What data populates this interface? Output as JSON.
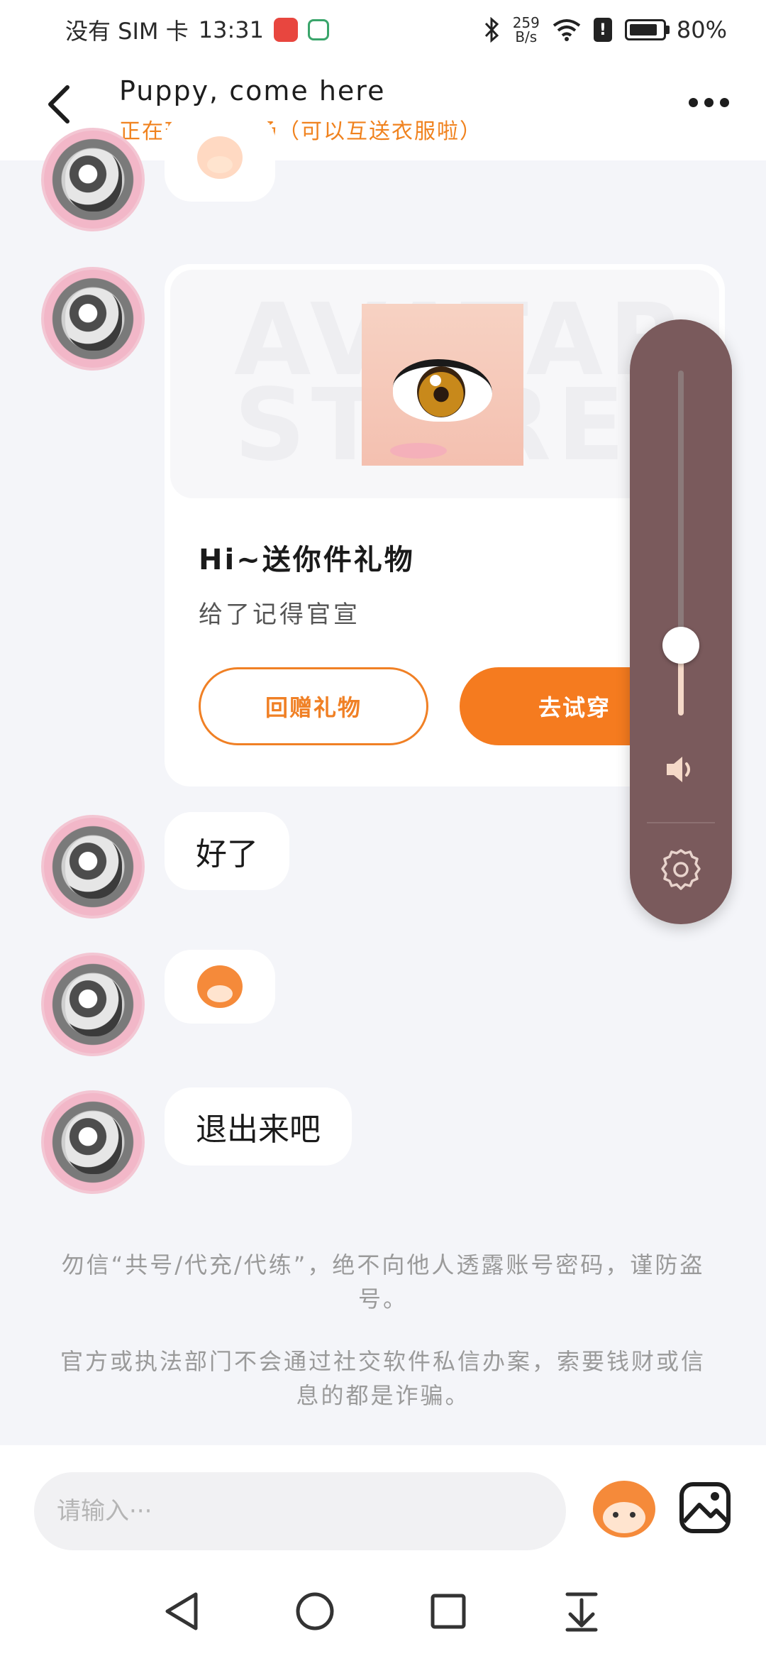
{
  "status_bar": {
    "carrier": "没有 SIM 卡",
    "time": "13:31",
    "net_speed_value": "259",
    "net_speed_unit": "B/s",
    "battery": "80%"
  },
  "header": {
    "title": "Puppy, come here",
    "subtitle": "正在玩心愿广场（可以互送衣服啦）"
  },
  "messages": [
    {
      "type": "emoji",
      "icon": "smiling-face-emoji"
    },
    {
      "type": "gift",
      "watermark": "AVATAR STORE",
      "title": "Hi~送你件礼物",
      "description": "给了记得官宣",
      "return_button": "回赠礼物",
      "try_button": "去试穿"
    },
    {
      "type": "text",
      "text": "好了"
    },
    {
      "type": "emoji",
      "icon": "yawning-face-emoji"
    },
    {
      "type": "text",
      "text": "退出来吧"
    }
  ],
  "notices": [
    "勿信“共号/代充/代练”，绝不向他人透露账号密码，谨防盗号。",
    "官方或执法部门不会通过社交软件私信办案，索要钱财或信息的都是诈骗。"
  ],
  "input": {
    "placeholder": "请输入···",
    "value": ""
  },
  "volume": {
    "level": 0.08,
    "accent_color": "#f5d9c8",
    "panel_color": "#7a5a5c"
  },
  "colors": {
    "accent": "#f57b1f",
    "subtitle": "#f0821e",
    "background": "#f4f5f9"
  },
  "navigation": [
    "back",
    "home",
    "recents",
    "notifications"
  ]
}
